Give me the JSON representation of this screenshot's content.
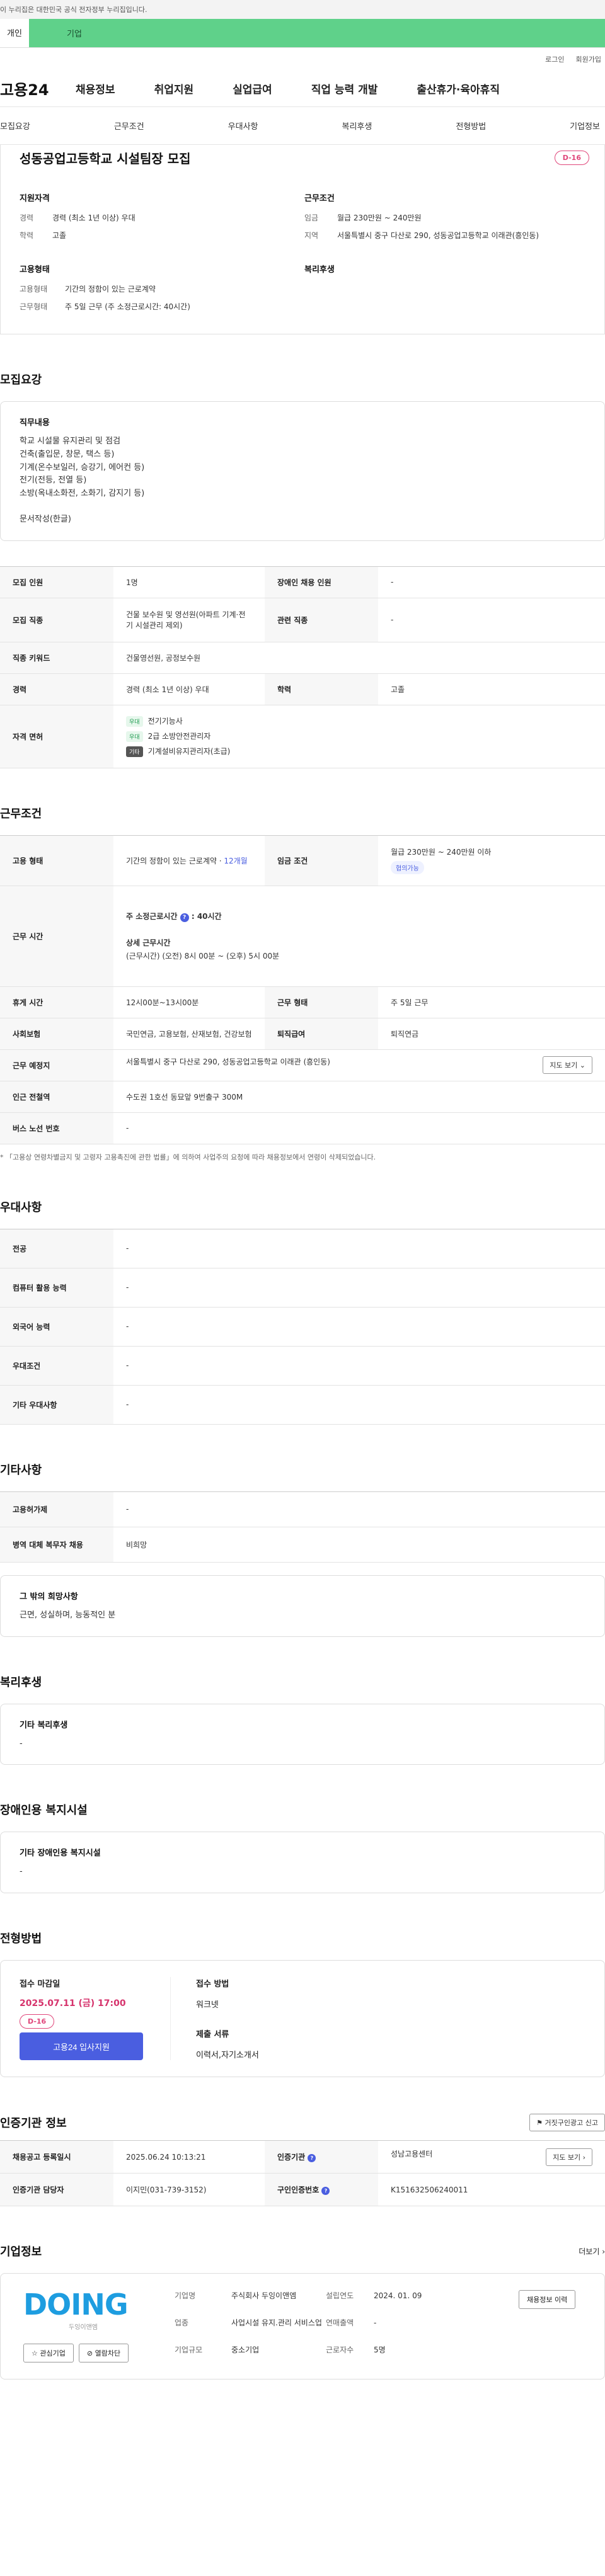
{
  "topbar": {
    "text": "이 누리집은 대한민국 공식 전자정부 누리집입니다."
  },
  "tabs": {
    "person": "개인",
    "company": "기업"
  },
  "util": {
    "login": "로그인",
    "join": "회원가입"
  },
  "gnb": {
    "logo": "고용24",
    "items": [
      "채용정보",
      "취업지원",
      "실업급여",
      "직업 능력 개발",
      "출산휴가·육아휴직"
    ]
  },
  "subnav": [
    "모집요강",
    "근무조건",
    "우대사항",
    "복리후생",
    "전형방법",
    "기업정보"
  ],
  "hero": {
    "title": "성동공업고등학교 시설팀장 모집",
    "dday": "D-16",
    "qual_title": "지원자격",
    "cond_title": "근무조건",
    "career_k": "경력",
    "career_v": "경력 (최소 1년 이상) 우대",
    "edu_k": "학력",
    "edu_v": "고졸",
    "pay_k": "임금",
    "pay_v": "월급 230만원 ~ 240만원",
    "loc_k": "지역",
    "loc_v": "서울특별시 중구 다산로 290, 성동공업고등학교 이래관(흥인동)",
    "emp_title": "고용형태",
    "welfare_title": "복리후생",
    "type_k": "고용형태",
    "type_v": "기간의 정함이 있는 근로계약",
    "work_k": "근무형태",
    "work_v": "주 5일 근무 (주 소정근로시간: 40시간)"
  },
  "recruit": {
    "title": "모집요강",
    "duty_title": "직무내용",
    "duty_lines": [
      "학교 시설물 유지관리 및 점검",
      "건축(출입문, 창문, 택스 등)",
      "기계(온수보일러, 승강기, 에어컨 등)",
      "전기(전등, 전열 등)",
      "소방(옥내소화전, 소화기, 감지기 등)",
      "",
      "문서작성(한글)"
    ],
    "count_k": "모집 인원",
    "count_v": "1명",
    "disabled_k": "장애인 채용 인원",
    "disabled_v": "-",
    "job_k": "모집 직종",
    "job_v": "건물 보수원 및 영선원(아파트 기계·전기 시설관리 제외)",
    "related_k": "관련 직종",
    "related_v": "-",
    "kw_k": "직종 키워드",
    "kw_v": "건물영선원, 공정보수원",
    "career_k": "경력",
    "career_v": "경력 (최소 1년 이상) 우대",
    "edu_k": "학력",
    "edu_v": "고졸",
    "lic_k": "자격 면허",
    "licenses": [
      {
        "tag": "우대",
        "name": "전기기능사"
      },
      {
        "tag": "우대",
        "name": "2급 소방안전관리자"
      },
      {
        "tag": "기타",
        "name": "기계설비유지관리자(초급)"
      }
    ]
  },
  "cond": {
    "title": "근무조건",
    "emp_k": "고용 형태",
    "emp_v": "기간의 정함이 있는 근로계약 · ",
    "emp_months": "12개월",
    "pay_k": "임금 조건",
    "pay_v": "월급 230만원 ~ 240만원 이하",
    "pay_badge": "협의가능",
    "time_k": "근무 시간",
    "time_main": "주 소정근로시간",
    "time_hours": "40시간",
    "time_detail_h": "상세 근무시간",
    "time_detail": "(근무시간) (오전) 8시 00분 ~ (오후) 5시 00분",
    "rest_k": "휴게 시간",
    "rest_v": "12시00분~13시00분",
    "form_k": "근무 형태",
    "form_v": "주 5일 근무",
    "ins_k": "사회보험",
    "ins_v": "국민연금, 고용보험, 산재보험, 건강보험",
    "ret_k": "퇴직급여",
    "ret_v": "퇴직연금",
    "place_k": "근무 예정지",
    "place_v": "서울특별시 중구 다산로 290, 성동공업고등학교 이래관 (흥인동)",
    "map_btn": "지도 보기",
    "sub_k": "인근 전철역",
    "sub_v": "수도권 1호선 동묘앞 9번출구 300M",
    "bus_k": "버스 노선 번호",
    "bus_v": "-",
    "note": "* 「고용상 연령차별금지 및 고령자 고용촉진에 관한 법률」에 의하여 사업주의 요청에 따라 채용정보에서 연령이 삭제되었습니다."
  },
  "pref": {
    "title": "우대사항",
    "rows": [
      {
        "k": "전공",
        "v": "-"
      },
      {
        "k": "컴퓨터 활용 능력",
        "v": "-"
      },
      {
        "k": "외국어 능력",
        "v": "-"
      },
      {
        "k": "우대조건",
        "v": "-"
      },
      {
        "k": "기타 우대사항",
        "v": "-"
      }
    ]
  },
  "etc": {
    "title": "기타사항",
    "rows": [
      {
        "k": "고용허가제",
        "v": "-"
      },
      {
        "k": "병역 대체 복무자 채용",
        "v": "비희망"
      }
    ],
    "wish_h": "그 밖의 희망사항",
    "wish_v": "근면, 성실하며, 능동적인 분"
  },
  "welfare": {
    "title": "복리후생",
    "box_h": "기타 복리후생",
    "box_v": "-"
  },
  "disabled": {
    "title": "장애인용 복지시설",
    "box_h": "기타 장애인용 복지시설",
    "box_v": "-"
  },
  "select": {
    "title": "전형방법",
    "deadline_h": "접수 마감일",
    "deadline_v": "2025.07.11 (금) 17:00",
    "dday": "D-16",
    "apply_btn": "고용24 입사지원",
    "method_h": "접수 방법",
    "method_v": "워크넷",
    "doc_h": "제출 서류",
    "doc_v": "이력서,자기소개서"
  },
  "cert": {
    "title": "인증기관 정보",
    "report_btn": "거짓구인광고 신고",
    "reg_k": "채용공고 등록일시",
    "reg_v": "2025.06.24 10:13:21",
    "org_k": "인증기관",
    "org_v": "성남고용센터",
    "map_btn": "지도 보기",
    "mgr_k": "인증기관 담당자",
    "mgr_v": "이지민(031-739-3152)",
    "num_k": "구인인증번호",
    "num_v": "K151632506240011"
  },
  "company": {
    "title": "기업정보",
    "more": "더보기",
    "logo": "DOING",
    "logo_sub": "두잉이앤엠",
    "fav_btn": "관심기업",
    "block_btn": "열람차단",
    "name_k": "기업명",
    "name_v": "주식회사 두잉이앤엠",
    "est_k": "설립연도",
    "est_v": "2024. 01. 09",
    "sales_k": "연매출액",
    "sales_v": "-",
    "ind_k": "업종",
    "ind_v": "사업시설 유지.관리 서비스업",
    "emp_k": "근로자수",
    "emp_v": "5명",
    "size_k": "기업규모",
    "size_v": "중소기업",
    "history_btn": "채용정보 이력"
  }
}
